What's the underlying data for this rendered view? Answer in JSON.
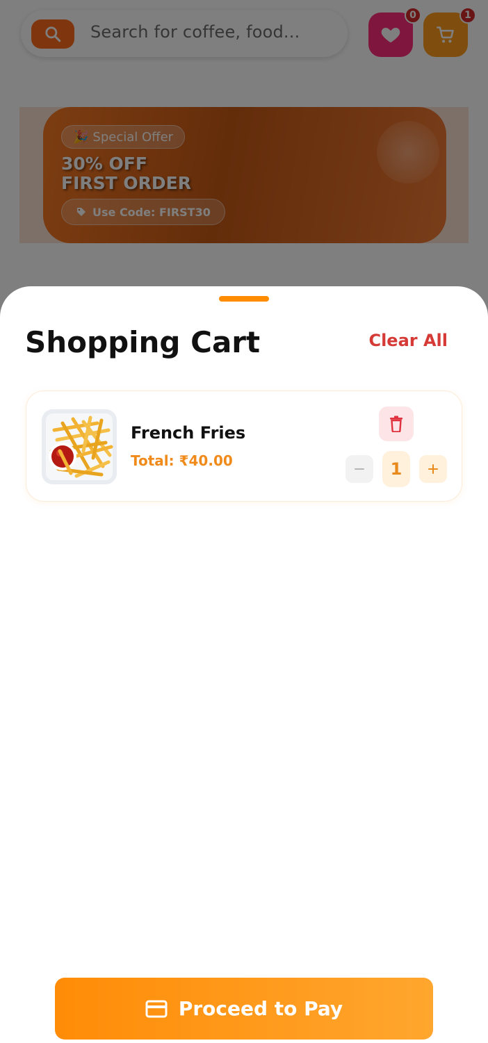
{
  "header": {
    "search_placeholder": "Search for coffee, food...",
    "favorites_count": "0",
    "cart_count": "1",
    "icons": {
      "search": "search-icon",
      "favorites": "heart-icon",
      "cart": "cart-icon"
    }
  },
  "promo": {
    "badge": "Special Offer",
    "title_line1": "30% OFF",
    "title_line2": "FIRST ORDER",
    "code": "Use Code: FIRST30",
    "icons": {
      "badge": "party-popper-icon",
      "code": "tag-icon"
    }
  },
  "cart": {
    "title": "Shopping Cart",
    "clear_all": "Clear All",
    "items": [
      {
        "name": "French Fries",
        "total": "Total: ₹40.00",
        "quantity": "1",
        "image": "french-fries-image"
      }
    ],
    "checkout_label": "Proceed to Pay",
    "icons": {
      "delete": "trash-icon",
      "minus": "minus-icon",
      "plus": "plus-icon",
      "checkout": "credit-card-icon"
    }
  },
  "colors": {
    "accent": "#ff8c00",
    "danger": "#d53a36",
    "favorites": "#ff2d7a",
    "cart": "#ff9d1c"
  }
}
